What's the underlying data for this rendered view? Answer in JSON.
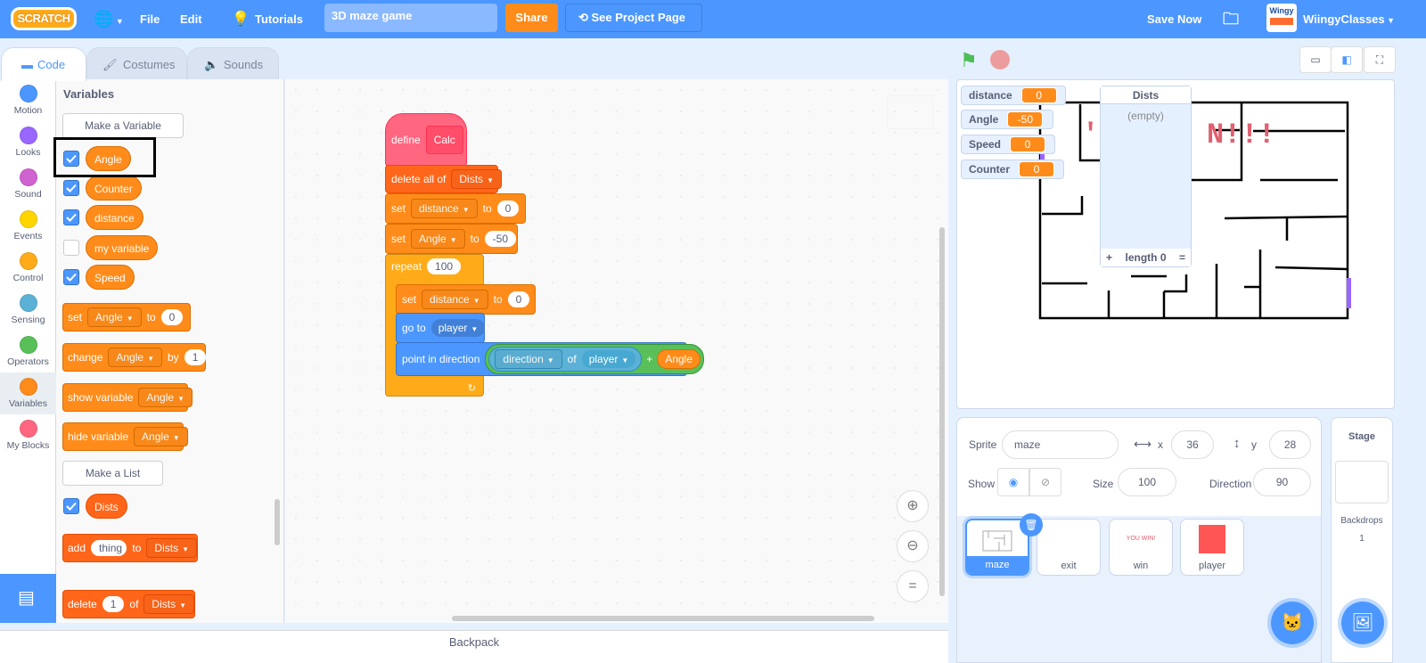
{
  "menubar": {
    "logo": "SCRATCH",
    "file": "File",
    "edit": "Edit",
    "tutorials": "Tutorials",
    "project_title": "3D maze game",
    "share": "Share",
    "see_project_page": "See Project Page",
    "save_now": "Save Now",
    "username": "WiingyClasses",
    "avatar_text": "Wingy"
  },
  "tabs": {
    "code": "Code",
    "costumes": "Costumes",
    "sounds": "Sounds"
  },
  "categories": [
    {
      "label": "Motion",
      "color": "#4c97ff"
    },
    {
      "label": "Looks",
      "color": "#9966ff"
    },
    {
      "label": "Sound",
      "color": "#cf63cf"
    },
    {
      "label": "Events",
      "color": "#ffd500"
    },
    {
      "label": "Control",
      "color": "#ffab19"
    },
    {
      "label": "Sensing",
      "color": "#5cb1d6"
    },
    {
      "label": "Operators",
      "color": "#59c059"
    },
    {
      "label": "Variables",
      "color": "#ff8c1a"
    },
    {
      "label": "My Blocks",
      "color": "#ff6680"
    }
  ],
  "palette": {
    "title": "Variables",
    "make_variable": "Make a Variable",
    "variables": [
      {
        "name": "Angle",
        "checked": true
      },
      {
        "name": "Counter",
        "checked": true
      },
      {
        "name": "distance",
        "checked": true
      },
      {
        "name": "my variable",
        "checked": false
      },
      {
        "name": "Speed",
        "checked": true
      }
    ],
    "set_block": {
      "label": "set",
      "var": "Angle",
      "to": "to",
      "value": "0"
    },
    "change_block": {
      "label": "change",
      "var": "Angle",
      "by": "by",
      "value": "1"
    },
    "show_block": {
      "label": "show variable",
      "var": "Angle"
    },
    "hide_block": {
      "label": "hide variable",
      "var": "Angle"
    },
    "make_list": "Make a List",
    "list": {
      "name": "Dists",
      "checked": true
    },
    "add_block": {
      "label": "add",
      "value": "thing",
      "to": "to",
      "list": "Dists"
    },
    "delete_block": {
      "label": "delete",
      "value": "1",
      "of": "of",
      "list": "Dists"
    }
  },
  "script": {
    "define": "define",
    "proc_name": "Calc",
    "delete_all": {
      "label": "delete all of",
      "list": "Dists"
    },
    "set1": {
      "label": "set",
      "var": "distance",
      "to": "to",
      "value": "0"
    },
    "set2": {
      "label": "set",
      "var": "Angle",
      "to": "to",
      "value": "-50"
    },
    "repeat": {
      "label": "repeat",
      "value": "100"
    },
    "set3": {
      "label": "set",
      "var": "distance",
      "to": "to",
      "value": "0"
    },
    "goto": {
      "label": "go to",
      "target": "player"
    },
    "point": {
      "label": "point in direction",
      "prop": "direction",
      "of": "of",
      "sprite": "player",
      "plus": "+",
      "var": "Angle"
    }
  },
  "backpack": "Backpack",
  "stage": {
    "monitors": [
      {
        "name": "distance",
        "value": "0"
      },
      {
        "name": "Angle",
        "value": "-50"
      },
      {
        "name": "Speed",
        "value": "0"
      },
      {
        "name": "Counter",
        "value": "0"
      }
    ],
    "list_monitor": {
      "title": "Dists",
      "empty": "(empty)",
      "plus": "+",
      "length": "length 0",
      "eq": "="
    },
    "banner_text": "N!!!"
  },
  "sprite_info": {
    "sprite_label": "Sprite",
    "sprite_name": "maze",
    "x_label": "x",
    "x": "36",
    "y_label": "y",
    "y": "28",
    "show_label": "Show",
    "size_label": "Size",
    "size": "100",
    "direction_label": "Direction",
    "direction": "90"
  },
  "sprites": [
    {
      "name": "maze",
      "selected": true
    },
    {
      "name": "exit"
    },
    {
      "name": "win",
      "thumb_text": "YOU WIN!"
    },
    {
      "name": "player"
    }
  ],
  "stage_pane": {
    "title": "Stage",
    "backdrops_label": "Backdrops",
    "backdrops_count": "1"
  }
}
